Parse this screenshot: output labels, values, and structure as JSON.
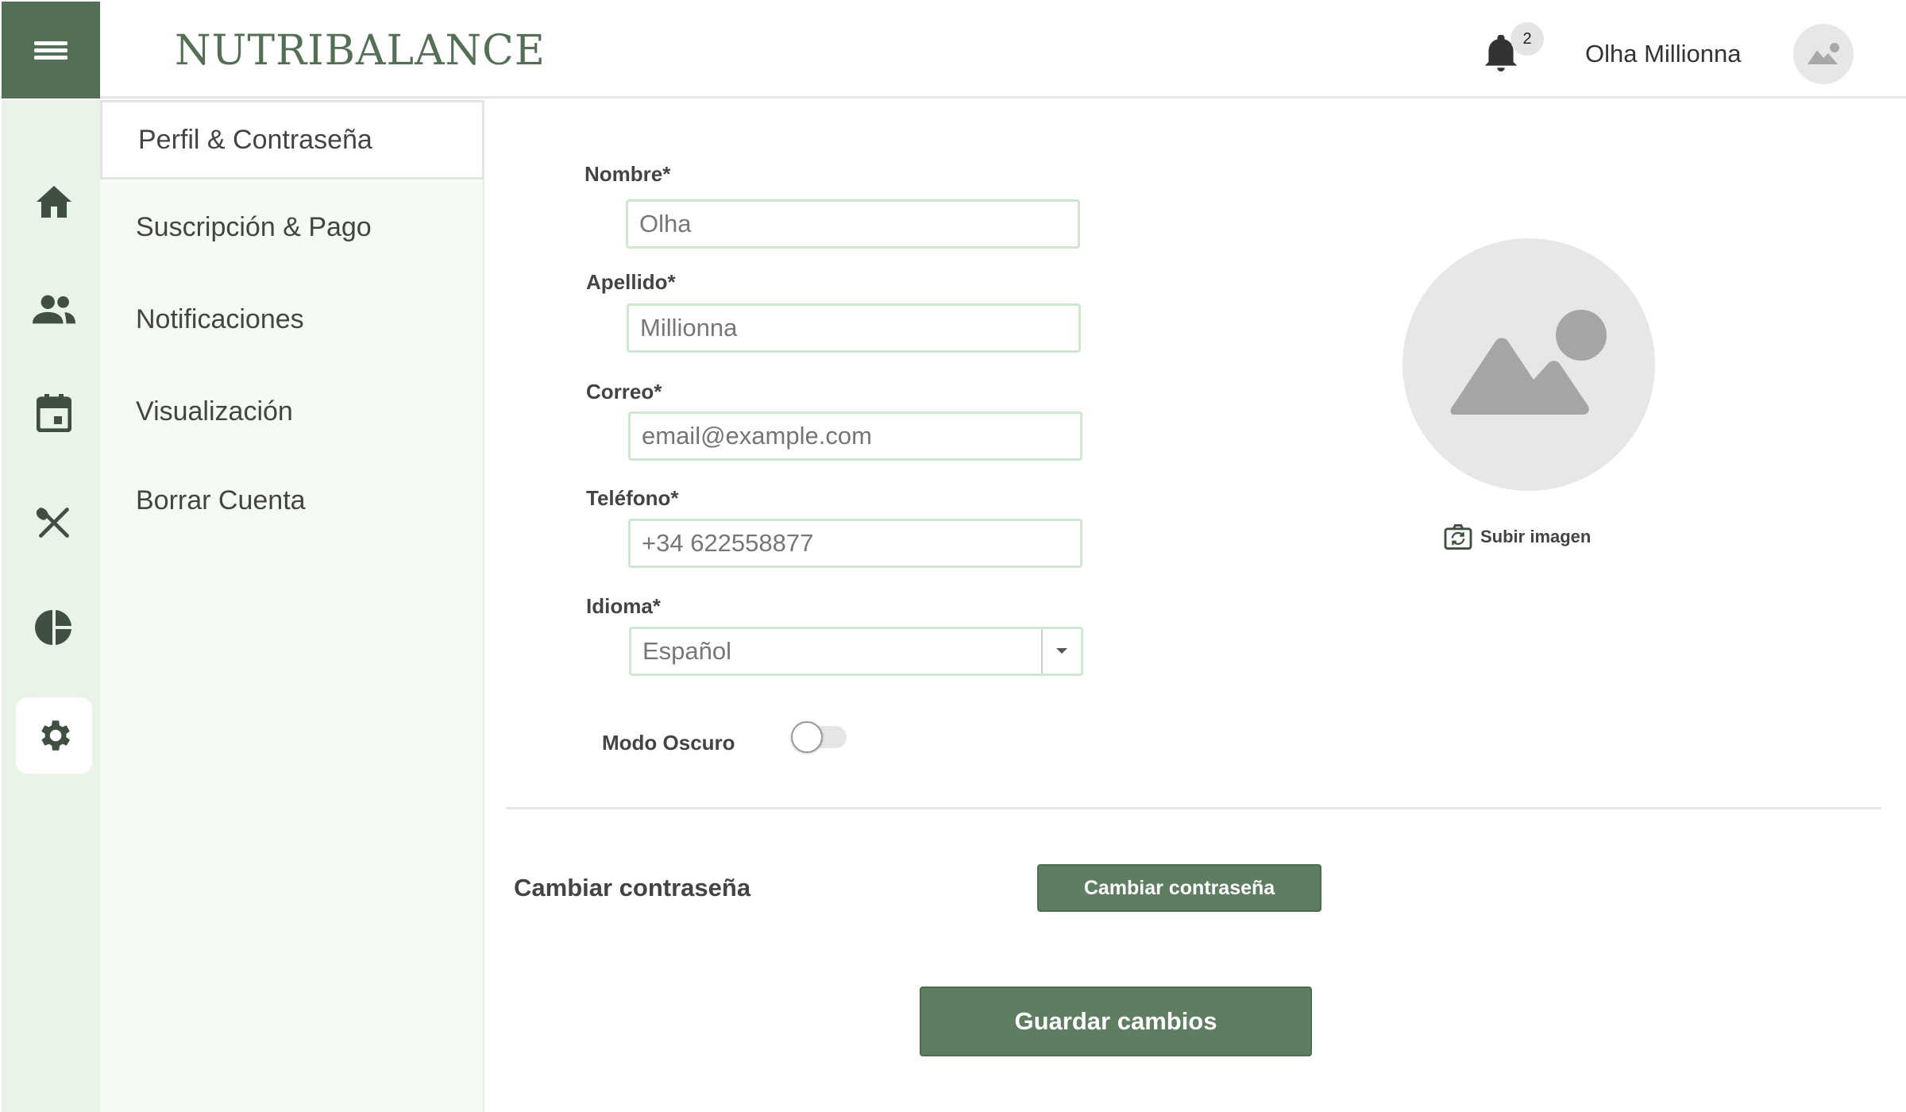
{
  "app": {
    "brand": "NUTRIBALANCE"
  },
  "header": {
    "notification_count": "2",
    "user_name": "Olha Millionna"
  },
  "rail": {
    "items": [
      {
        "icon": "home-icon"
      },
      {
        "icon": "people-icon"
      },
      {
        "icon": "calendar-icon"
      },
      {
        "icon": "utensils-icon"
      },
      {
        "icon": "pie-chart-icon"
      },
      {
        "icon": "gear-icon",
        "active": true
      }
    ]
  },
  "submenu": {
    "items": [
      {
        "label": "Perfil & Contraseña",
        "active": true
      },
      {
        "label": "Suscripción & Pago"
      },
      {
        "label": "Notificaciones"
      },
      {
        "label": "Visualización"
      },
      {
        "label": "Borrar Cuenta"
      }
    ]
  },
  "form": {
    "nombre": {
      "label": "Nombre*",
      "value": "Olha"
    },
    "apellido": {
      "label": "Apellido*",
      "value": "Millionna"
    },
    "correo": {
      "label": "Correo*",
      "placeholder": "email@example.com"
    },
    "telefono": {
      "label": "Teléfono*",
      "value": "+34 622558877"
    },
    "idioma": {
      "label": "Idioma*",
      "value": "Español"
    },
    "dark_mode": {
      "label": "Modo Oscuro",
      "enabled": false
    }
  },
  "image": {
    "upload_label": "Subir imagen"
  },
  "password": {
    "label": "Cambiar contraseña",
    "button": "Cambiar contraseña"
  },
  "save_button": "Guardar cambios",
  "colors": {
    "primary": "#546f55",
    "rail_bg": "#e9f3e7",
    "submenu_bg": "#f5fbf2",
    "field_border": "#cfe7cf"
  }
}
